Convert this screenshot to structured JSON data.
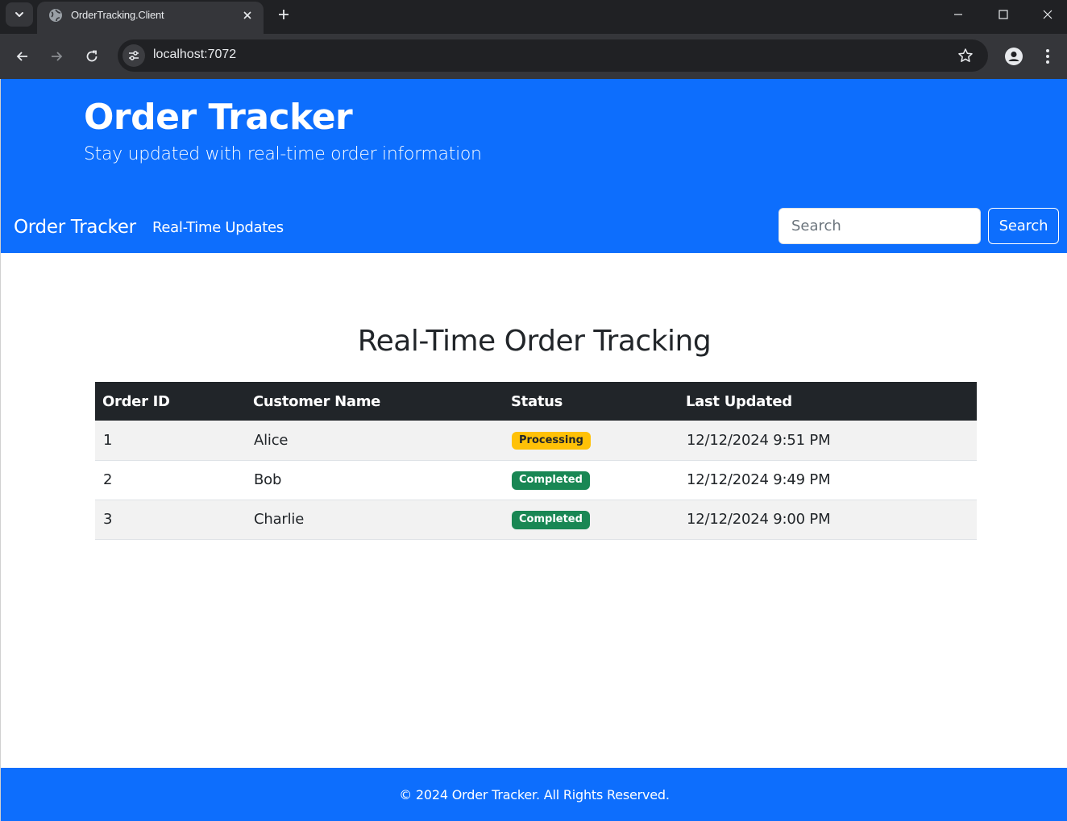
{
  "browser": {
    "tab_title": "OrderTracking.Client",
    "url": "localhost:7072"
  },
  "header": {
    "title": "Order Tracker",
    "subtitle": "Stay updated with real-time order information"
  },
  "navbar": {
    "brand": "Order Tracker",
    "links": [
      {
        "label": "Real-Time Updates"
      }
    ],
    "search_placeholder": "Search",
    "search_button": "Search"
  },
  "main": {
    "title": "Real-Time Order Tracking",
    "table": {
      "columns": [
        "Order ID",
        "Customer Name",
        "Status",
        "Last Updated"
      ],
      "rows": [
        {
          "id": "1",
          "customer": "Alice",
          "status": "Processing",
          "updated": "12/12/2024 9:51 PM"
        },
        {
          "id": "2",
          "customer": "Bob",
          "status": "Completed",
          "updated": "12/12/2024 9:49 PM"
        },
        {
          "id": "3",
          "customer": "Charlie",
          "status": "Completed",
          "updated": "12/12/2024 9:00 PM"
        }
      ]
    }
  },
  "footer": {
    "text": "© 2024 Order Tracker. All Rights Reserved."
  },
  "colors": {
    "primary": "#0d6efd",
    "table_header": "#212529",
    "badge_processing": "#ffc107",
    "badge_completed": "#198754"
  },
  "icons": {
    "tab_search": "chevron-down-icon",
    "favicon": "globe-icon",
    "tab_close": "close-icon",
    "new_tab": "plus-icon",
    "back": "arrow-left-icon",
    "forward": "arrow-right-icon",
    "reload": "reload-icon",
    "site_info": "tune-icon",
    "bookmark": "star-icon",
    "profile": "person-icon",
    "menu": "kebab-menu-icon"
  }
}
